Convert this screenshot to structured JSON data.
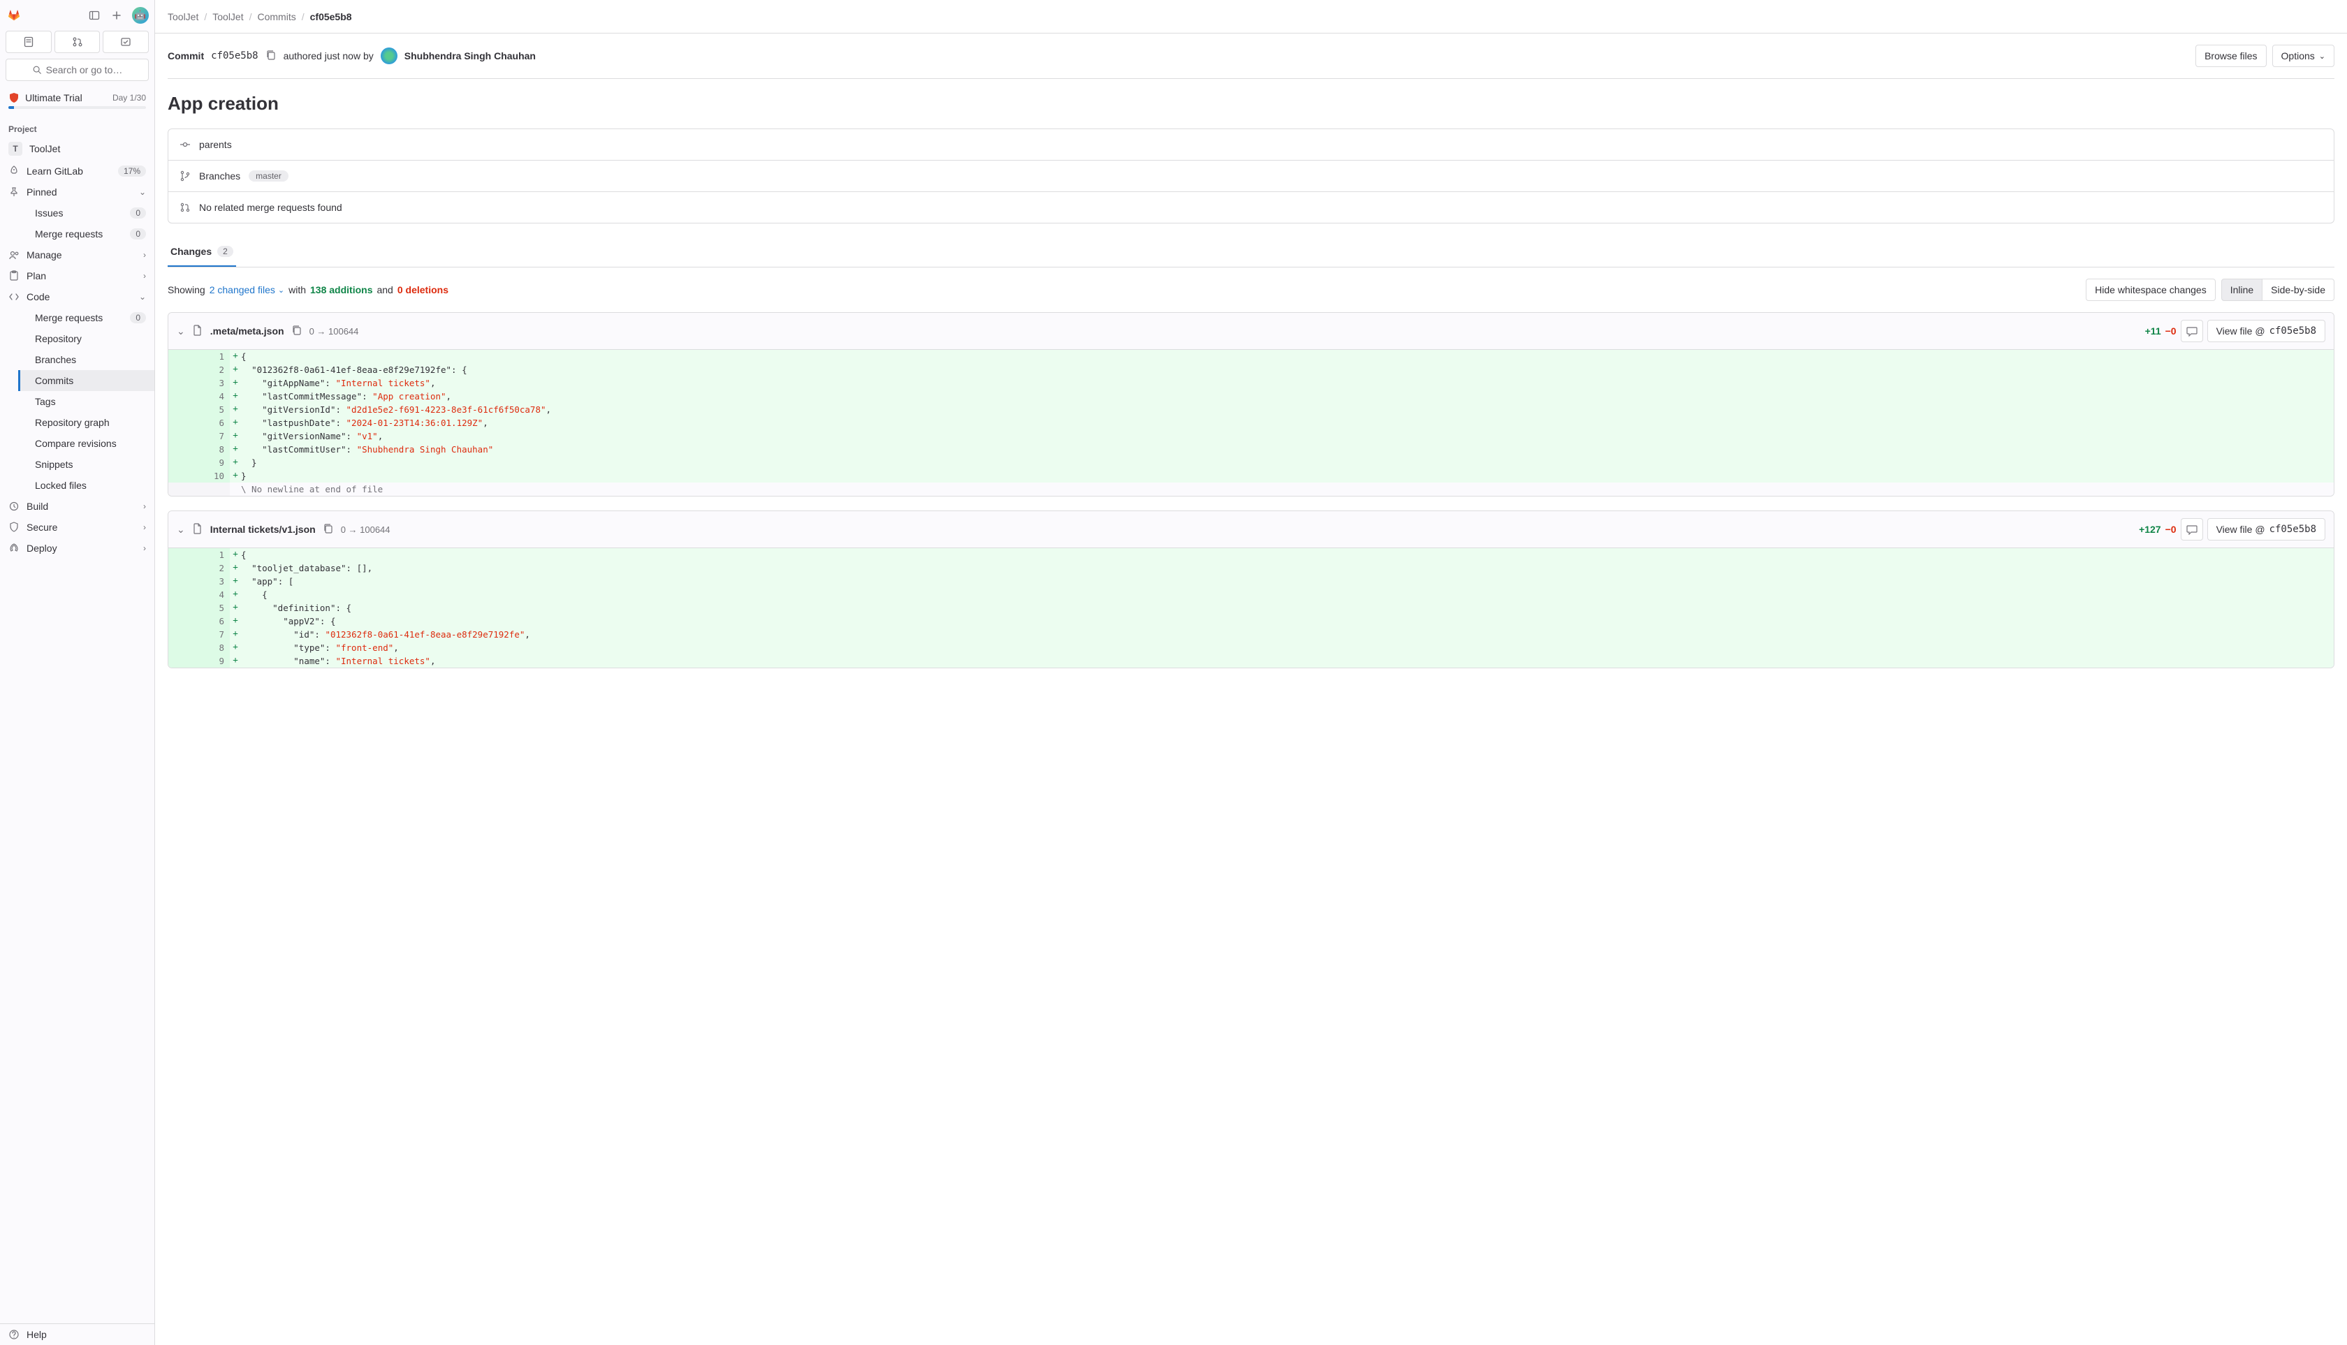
{
  "breadcrumbs": [
    "ToolJet",
    "ToolJet",
    "Commits",
    "cf05e5b8"
  ],
  "sidebar": {
    "search_placeholder": "Search or go to…",
    "trial": {
      "label": "Ultimate Trial",
      "days": "Day 1/30"
    },
    "project_section": "Project",
    "project_name": "ToolJet",
    "project_badge": "T",
    "items": {
      "learn_gitlab": "Learn GitLab",
      "learn_gitlab_pct": "17%",
      "pinned": "Pinned",
      "issues": "Issues",
      "issues_count": "0",
      "merge_requests": "Merge requests",
      "merge_requests_count": "0",
      "manage": "Manage",
      "plan": "Plan",
      "code": "Code",
      "code_children": {
        "merge_requests": "Merge requests",
        "merge_requests_count": "0",
        "repository": "Repository",
        "branches": "Branches",
        "commits": "Commits",
        "tags": "Tags",
        "repository_graph": "Repository graph",
        "compare_revisions": "Compare revisions",
        "snippets": "Snippets",
        "locked_files": "Locked files"
      },
      "build": "Build",
      "secure": "Secure",
      "deploy": "Deploy"
    },
    "help": "Help"
  },
  "commit": {
    "prefix": "Commit",
    "sha": "cf05e5b8",
    "authored_text": "authored just now by",
    "author_name": "Shubhendra Singh Chauhan",
    "title": "App creation",
    "browse_files": "Browse files",
    "options": "Options"
  },
  "meta": {
    "parents": "parents",
    "branches": "Branches",
    "branch_chip": "master",
    "no_mr": "No related merge requests found"
  },
  "tabs": {
    "changes": "Changes",
    "changes_count": "2"
  },
  "summary": {
    "showing": "Showing",
    "changed_files": "2 changed files",
    "with": "with",
    "additions": "138 additions",
    "and": "and",
    "deletions": "0 deletions",
    "hide_ws": "Hide whitespace changes",
    "inline": "Inline",
    "side_by_side": "Side-by-side"
  },
  "files": [
    {
      "name": ".meta/meta.json",
      "mode": "0 → 100644",
      "plus": "+11",
      "minus": "−0",
      "view_file": "View file @",
      "view_sha": "cf05e5b8",
      "lines": [
        {
          "n": 1,
          "type": "add",
          "tokens": [
            {
              "t": "plain",
              "v": "{"
            }
          ]
        },
        {
          "n": 2,
          "type": "add",
          "tokens": [
            {
              "t": "plain",
              "v": "  "
            },
            {
              "t": "key",
              "v": "\"012362f8-0a61-41ef-8eaa-e8f29e7192fe\""
            },
            {
              "t": "plain",
              "v": ": {"
            }
          ]
        },
        {
          "n": 3,
          "type": "add",
          "tokens": [
            {
              "t": "plain",
              "v": "    "
            },
            {
              "t": "key",
              "v": "\"gitAppName\""
            },
            {
              "t": "plain",
              "v": ": "
            },
            {
              "t": "str",
              "v": "\"Internal tickets\""
            },
            {
              "t": "plain",
              "v": ","
            }
          ]
        },
        {
          "n": 4,
          "type": "add",
          "tokens": [
            {
              "t": "plain",
              "v": "    "
            },
            {
              "t": "key",
              "v": "\"lastCommitMessage\""
            },
            {
              "t": "plain",
              "v": ": "
            },
            {
              "t": "str",
              "v": "\"App creation\""
            },
            {
              "t": "plain",
              "v": ","
            }
          ]
        },
        {
          "n": 5,
          "type": "add",
          "tokens": [
            {
              "t": "plain",
              "v": "    "
            },
            {
              "t": "key",
              "v": "\"gitVersionId\""
            },
            {
              "t": "plain",
              "v": ": "
            },
            {
              "t": "str",
              "v": "\"d2d1e5e2-f691-4223-8e3f-61cf6f50ca78\""
            },
            {
              "t": "plain",
              "v": ","
            }
          ]
        },
        {
          "n": 6,
          "type": "add",
          "tokens": [
            {
              "t": "plain",
              "v": "    "
            },
            {
              "t": "key",
              "v": "\"lastpushDate\""
            },
            {
              "t": "plain",
              "v": ": "
            },
            {
              "t": "str",
              "v": "\"2024-01-23T14:36:01.129Z\""
            },
            {
              "t": "plain",
              "v": ","
            }
          ]
        },
        {
          "n": 7,
          "type": "add",
          "tokens": [
            {
              "t": "plain",
              "v": "    "
            },
            {
              "t": "key",
              "v": "\"gitVersionName\""
            },
            {
              "t": "plain",
              "v": ": "
            },
            {
              "t": "str",
              "v": "\"v1\""
            },
            {
              "t": "plain",
              "v": ","
            }
          ]
        },
        {
          "n": 8,
          "type": "add",
          "tokens": [
            {
              "t": "plain",
              "v": "    "
            },
            {
              "t": "key",
              "v": "\"lastCommitUser\""
            },
            {
              "t": "plain",
              "v": ": "
            },
            {
              "t": "str",
              "v": "\"Shubhendra Singh Chauhan\""
            }
          ]
        },
        {
          "n": 9,
          "type": "add",
          "tokens": [
            {
              "t": "plain",
              "v": "  }"
            }
          ]
        },
        {
          "n": 10,
          "type": "add",
          "tokens": [
            {
              "t": "plain",
              "v": "}"
            }
          ]
        },
        {
          "n": null,
          "type": "meta",
          "tokens": [
            {
              "t": "plain",
              "v": "\\ No newline at end of file"
            }
          ]
        }
      ]
    },
    {
      "name": "Internal tickets/v1.json",
      "mode": "0 → 100644",
      "plus": "+127",
      "minus": "−0",
      "view_file": "View file @",
      "view_sha": "cf05e5b8",
      "lines": [
        {
          "n": 1,
          "type": "add",
          "tokens": [
            {
              "t": "plain",
              "v": "{"
            }
          ]
        },
        {
          "n": 2,
          "type": "add",
          "tokens": [
            {
              "t": "plain",
              "v": "  "
            },
            {
              "t": "key",
              "v": "\"tooljet_database\""
            },
            {
              "t": "plain",
              "v": ": [],"
            }
          ]
        },
        {
          "n": 3,
          "type": "add",
          "tokens": [
            {
              "t": "plain",
              "v": "  "
            },
            {
              "t": "key",
              "v": "\"app\""
            },
            {
              "t": "plain",
              "v": ": ["
            }
          ]
        },
        {
          "n": 4,
          "type": "add",
          "tokens": [
            {
              "t": "plain",
              "v": "    {"
            }
          ]
        },
        {
          "n": 5,
          "type": "add",
          "tokens": [
            {
              "t": "plain",
              "v": "      "
            },
            {
              "t": "key",
              "v": "\"definition\""
            },
            {
              "t": "plain",
              "v": ": {"
            }
          ]
        },
        {
          "n": 6,
          "type": "add",
          "tokens": [
            {
              "t": "plain",
              "v": "        "
            },
            {
              "t": "key",
              "v": "\"appV2\""
            },
            {
              "t": "plain",
              "v": ": {"
            }
          ]
        },
        {
          "n": 7,
          "type": "add",
          "tokens": [
            {
              "t": "plain",
              "v": "          "
            },
            {
              "t": "key",
              "v": "\"id\""
            },
            {
              "t": "plain",
              "v": ": "
            },
            {
              "t": "str",
              "v": "\"012362f8-0a61-41ef-8eaa-e8f29e7192fe\""
            },
            {
              "t": "plain",
              "v": ","
            }
          ]
        },
        {
          "n": 8,
          "type": "add",
          "tokens": [
            {
              "t": "plain",
              "v": "          "
            },
            {
              "t": "key",
              "v": "\"type\""
            },
            {
              "t": "plain",
              "v": ": "
            },
            {
              "t": "str",
              "v": "\"front-end\""
            },
            {
              "t": "plain",
              "v": ","
            }
          ]
        },
        {
          "n": 9,
          "type": "add",
          "tokens": [
            {
              "t": "plain",
              "v": "          "
            },
            {
              "t": "key",
              "v": "\"name\""
            },
            {
              "t": "plain",
              "v": ": "
            },
            {
              "t": "str",
              "v": "\"Internal tickets\""
            },
            {
              "t": "plain",
              "v": ","
            }
          ]
        }
      ]
    }
  ]
}
